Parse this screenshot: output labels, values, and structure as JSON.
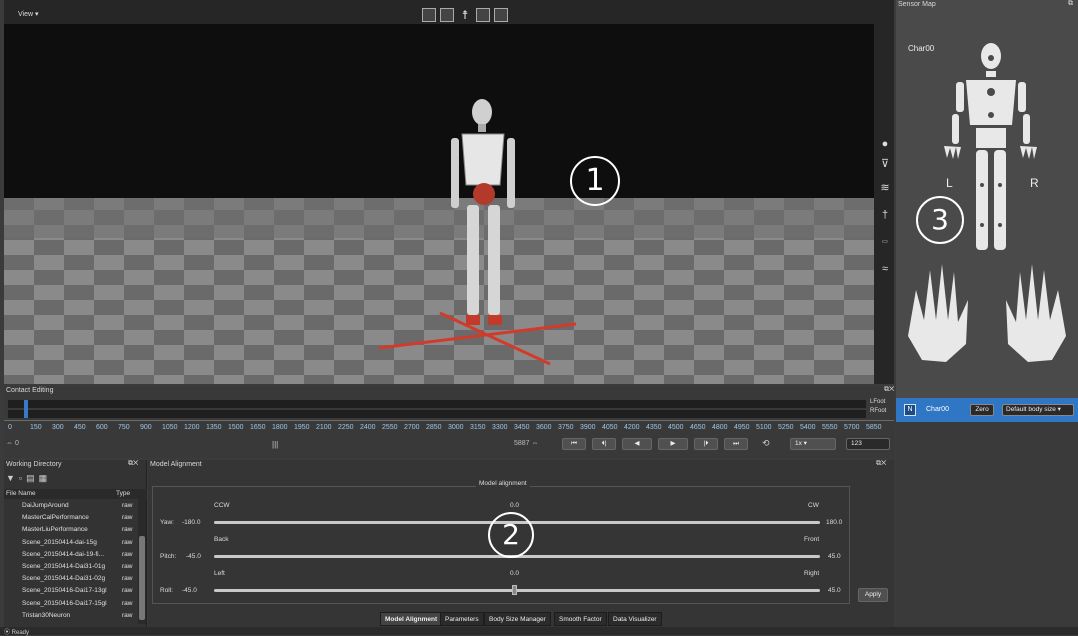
{
  "viewport": {
    "view_menu": "View",
    "toolbar_icons": [
      "checker-icon",
      "monitor-icon",
      "person-icon",
      "window-icon",
      "grid-icon"
    ],
    "side_tools": [
      "circle-icon",
      "cup-icon",
      "contact-icon",
      "body-icon",
      "zero-icon",
      "wave-icon"
    ],
    "annotation": "1"
  },
  "contact_editing": {
    "title": "Contact Editing",
    "track_labels": [
      "LFoot",
      "RFoot"
    ],
    "ticks": [
      "0",
      "150",
      "300",
      "450",
      "600",
      "750",
      "900",
      "1050",
      "1200",
      "1350",
      "1500",
      "1650",
      "1800",
      "1950",
      "2100",
      "2250",
      "2400",
      "2550",
      "2700",
      "2850",
      "3000",
      "3150",
      "3300",
      "3450",
      "3600",
      "3750",
      "3900",
      "4050",
      "4200",
      "4350",
      "4500",
      "4650",
      "4800",
      "4950",
      "5100",
      "5250",
      "5400",
      "5550",
      "5700",
      "5850"
    ],
    "start_frame": "0",
    "end_frame": "5887",
    "speed": "1x",
    "frame_field": "123"
  },
  "working_directory": {
    "title": "Working Directory",
    "col_name": "File Name",
    "col_type": "Type",
    "files": [
      {
        "name": "DaiJumpAround",
        "type": "raw"
      },
      {
        "name": "MasterCalPerformance",
        "type": "raw"
      },
      {
        "name": "MasterLiuPerformance",
        "type": "raw"
      },
      {
        "name": "Scene_20150414-dai-15g",
        "type": "raw"
      },
      {
        "name": "Scene_20150414-dai-19-fi...",
        "type": "raw"
      },
      {
        "name": "Scene_20150414-Dai31-01g",
        "type": "raw"
      },
      {
        "name": "Scene_20150414-Dai31-02g",
        "type": "raw"
      },
      {
        "name": "Scene_20150416-Dai17-13gl",
        "type": "raw"
      },
      {
        "name": "Scene_20150416-Dai17-15gl",
        "type": "raw"
      },
      {
        "name": "Tristan30Neuron",
        "type": "raw"
      }
    ]
  },
  "model_alignment": {
    "title": "Model Alignment",
    "group_title": "Model alignment",
    "yaw": {
      "label": "Yaw:",
      "min": "-180.0",
      "max": "180.0",
      "left": "CCW",
      "center": "0.0",
      "right": "CW"
    },
    "pitch": {
      "label": "Pitch:",
      "min": "-45.0",
      "max": "45.0",
      "left": "Back",
      "right": "Front"
    },
    "roll": {
      "label": "Roll:",
      "min": "-45.0",
      "max": "45.0",
      "left": "Left",
      "center": "0.0",
      "right": "Right"
    },
    "apply": "Apply",
    "annotation": "2",
    "tabs": [
      "Model Alignment",
      "Parameters",
      "Body Size Manager",
      "Smooth Factor",
      "Data Visualizer"
    ]
  },
  "sensor_map": {
    "title": "Sensor Map",
    "character": "Char00",
    "left_label": "L",
    "right_label": "R",
    "annotation": "3"
  },
  "char_bar": {
    "badge": "N",
    "name": "Char00",
    "zero": "Zero",
    "body_size": "Default body size"
  },
  "status": "Ready"
}
